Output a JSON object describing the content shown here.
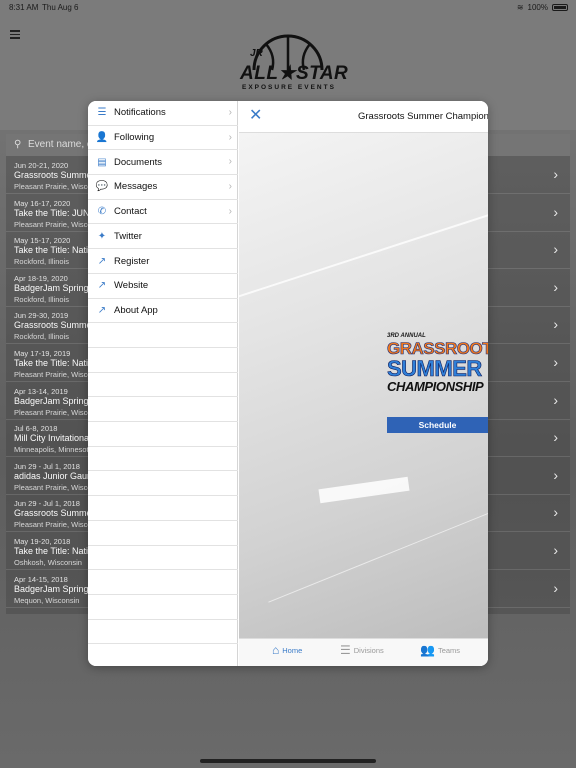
{
  "status": {
    "time": "8:31 AM",
    "date": "Thu Aug 6",
    "battery": "100%"
  },
  "logo": {
    "jr": "JR",
    "allstar": "ALL★STAR",
    "subtitle": "EXPOSURE EVENTS"
  },
  "search": {
    "placeholder": "Event name, c"
  },
  "events": [
    {
      "date": "Jun 20-21, 2020",
      "title": "Grassroots Summer",
      "location": "Pleasant Prairie, Wisco"
    },
    {
      "date": "May 16-17, 2020",
      "title": "Take the Title: JUNI",
      "location": "Pleasant Prairie, Wisco"
    },
    {
      "date": "May 15-17, 2020",
      "title": "Take the Title: Natio",
      "location": "Rockford, Illinois"
    },
    {
      "date": "Apr 18-19, 2020",
      "title": "BadgerJam Spring C",
      "location": "Rockford, Illinois"
    },
    {
      "date": "Jun 29-30, 2019",
      "title": "Grassroots Summer",
      "location": "Rockford, Illinois"
    },
    {
      "date": "May 17-19, 2019",
      "title": "Take the Title: Natio",
      "location": "Pleasant Prairie, Wisco"
    },
    {
      "date": "Apr 13-14, 2019",
      "title": "BadgerJam Spring C",
      "location": "Pleasant Prairie, Wisco"
    },
    {
      "date": "Jul 6-8, 2018",
      "title": "Mill City Invitational",
      "location": "Minneapolis, Minnesot"
    },
    {
      "date": "Jun 29 - Jul 1, 2018",
      "title": "adidas Junior Gaunt",
      "location": "Pleasant Prairie, Wisco"
    },
    {
      "date": "Jun 29 - Jul 1, 2018",
      "title": "Grassroots Summer",
      "location": "Pleasant Prairie, Wisco"
    },
    {
      "date": "May 19-20, 2018",
      "title": "Take the Title: Natio",
      "location": "Oshkosh, Wisconsin"
    },
    {
      "date": "Apr 14-15, 2018",
      "title": "BadgerJam Spring C",
      "location": "Mequon, Wisconsin"
    }
  ],
  "menu": [
    {
      "label": "Notifications",
      "icon": "rss-icon",
      "glyph": "☰",
      "arrow": true
    },
    {
      "label": "Following",
      "icon": "user-plus-icon",
      "glyph": "👤",
      "arrow": true
    },
    {
      "label": "Documents",
      "icon": "documents-icon",
      "glyph": "▤",
      "arrow": true
    },
    {
      "label": "Messages",
      "icon": "chat-icon",
      "glyph": "💬",
      "arrow": true
    },
    {
      "label": "Contact",
      "icon": "phone-icon",
      "glyph": "✆",
      "arrow": true
    },
    {
      "label": "Twitter",
      "icon": "twitter-icon",
      "glyph": "✦",
      "arrow": false
    },
    {
      "label": "Register",
      "icon": "external-link-icon",
      "glyph": "↗",
      "arrow": false
    },
    {
      "label": "Website",
      "icon": "external-link-icon",
      "glyph": "↗",
      "arrow": false
    },
    {
      "label": "About App",
      "icon": "external-link-icon",
      "glyph": "↗",
      "arrow": false
    }
  ],
  "detail": {
    "title": "Grassroots Summer Championshi",
    "event_logo": {
      "annual": "3RD ANNUAL",
      "line1": "GRASSROOTS",
      "line2": "SUMMER",
      "line3": "CHAMPIONSHIP"
    },
    "schedule_label": "Schedule"
  },
  "tabs": [
    {
      "label": "Home",
      "icon": "home-icon",
      "glyph": "⌂"
    },
    {
      "label": "Divisions",
      "icon": "list-icon",
      "glyph": "☰"
    },
    {
      "label": "Teams",
      "icon": "teams-icon",
      "glyph": "👥"
    }
  ],
  "colors": {
    "accent": "#3a7bc8",
    "schedule_button": "#2f63b6"
  }
}
